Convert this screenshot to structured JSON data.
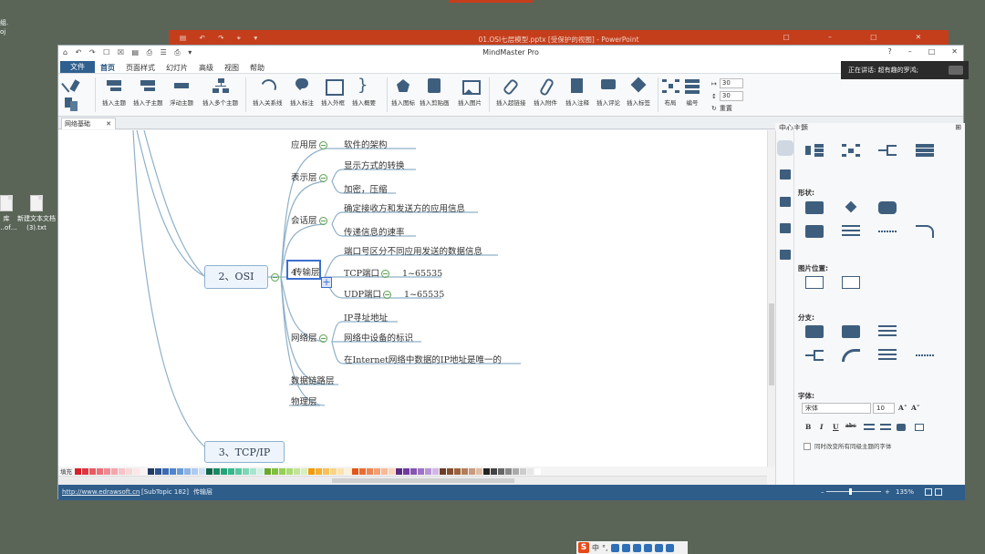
{
  "desktop": {
    "top_left_labels": [
      "组.",
      "oj"
    ],
    "icons": [
      {
        "label": "库\n…of…",
        "name": "desktop-file-partial"
      },
      {
        "label": "新建文本文档\n(3).txt",
        "name": "desktop-new-text-document"
      }
    ]
  },
  "powerpoint": {
    "title": "01.OSI七层模型.pptx [受保护的视图] - PowerPoint",
    "qat": "▤ ↶ ↷ ⌖ ▾",
    "controls": "□ – □ ✕"
  },
  "app": {
    "title": "MindMaster Pro",
    "qat": "⌂ ↶ ↷ ☐ ☒ ▤ ⎙ ☰ ⎙ ▾",
    "win_controls": [
      "?",
      "–",
      "□",
      "✕"
    ]
  },
  "menu": {
    "file": "文件",
    "tabs": [
      "首页",
      "页面样式",
      "幻灯片",
      "高级",
      "视图",
      "帮助"
    ],
    "active_index": 0
  },
  "ribbon": {
    "buttons": [
      "插入主题",
      "插入子主题",
      "浮动主题",
      "插入多个主题",
      "插入关系线",
      "插入标注",
      "插入外框",
      "插入概要",
      "插入图标",
      "插入剪贴画",
      "插入图片",
      "插入超链接",
      "插入附件",
      "插入注释",
      "插入评论",
      "插入标签",
      "布局",
      "编号"
    ],
    "spacing_h": "30",
    "spacing_v": "30",
    "reset": "重置"
  },
  "doc_tab": {
    "label": "网络基础",
    "close": "✕"
  },
  "mindmap": {
    "osi": "2、OSI",
    "tcpip": "3、TCP/IP",
    "layers": {
      "app": "应用层",
      "pres": "表示层",
      "session": "会话层",
      "transport": "传输层",
      "transport_cursor": "4",
      "network": "网络层",
      "datalink": "数据链路层",
      "physical": "物理层"
    },
    "details": {
      "app_1": "软件的架构",
      "pres_1": "显示方式的转换",
      "pres_2": "加密，压缩",
      "session_1": "确定接收方和发送方的应用信息",
      "session_2": "传递信息的速率",
      "transport_1": "端口号区分不同应用发送的数据信息",
      "tcp": "TCP端口",
      "tcp_range": "1~65535",
      "udp": "UDP端口",
      "udp_range": "1~65535",
      "net_1": "IP寻址地址",
      "net_2": "网络中设备的标识",
      "net_3": "在Internet网络中数据的IP地址是唯一的"
    }
  },
  "palette": {
    "label": "填充",
    "colors": [
      "#d6202c",
      "#e03640",
      "#e85a63",
      "#ec7179",
      "#ef8a91",
      "#f3a6ac",
      "#f7c3c7",
      "#f9d6d9",
      "#fbe6e8",
      "#fdf2f3",
      "#1f3b66",
      "#2c5290",
      "#3a6bb5",
      "#4f83ce",
      "#6a9bdb",
      "#8bb3e6",
      "#aecbef",
      "#cfe0f6",
      "#10654a",
      "#1a8a63",
      "#25a47a",
      "#38b68c",
      "#58c7a0",
      "#7fd5b7",
      "#a9e4ce",
      "#d2f1e5",
      "#6aa72b",
      "#7fbf3a",
      "#96cf54",
      "#aadb72",
      "#c1e596",
      "#d8efbb",
      "#f29a0b",
      "#f6ae2f",
      "#f8c15a",
      "#fad384",
      "#fce3ad",
      "#fdf0d4",
      "#e0561b",
      "#e86c34",
      "#ee8552",
      "#f29f74",
      "#f6ba98",
      "#fad4bd",
      "#5b2c83",
      "#6f3c9c",
      "#8655b3",
      "#9e73c5",
      "#b894d6",
      "#d2b7e6",
      "#6b3e24",
      "#844f2f",
      "#9c633e",
      "#b47d58",
      "#c99b7d",
      "#ddbda5",
      "#222222",
      "#444444",
      "#666666",
      "#888888",
      "#aaaaaa",
      "#cccccc",
      "#e6e6e6",
      "#ffffff"
    ]
  },
  "panel": {
    "title": "中心主题",
    "pin": "⊞",
    "sections": {
      "shape": "形状:",
      "image_pos": "图片位置:",
      "branch": "分支:",
      "font": "字体:"
    },
    "font_name": "宋体",
    "font_size": "10",
    "font_grow": "A˄",
    "font_shrink": "A˅",
    "format_buttons": [
      "B",
      "I",
      "U",
      "abc"
    ],
    "checkbox_label": "同时改变所有同级主题的字体"
  },
  "status": {
    "url": "http://www.edrawsoft.cn",
    "subtopic": "[SubTopic 182]",
    "selection": "传输层",
    "zoom_minus": "–",
    "zoom_plus": "+",
    "zoom_value": "135%",
    "zoom_fraction": 0.44
  },
  "notification": {
    "text": "正在讲话: 超有趣的罗鸿;"
  },
  "ime": {
    "logo": "S",
    "mode": "中",
    "punct": "°,"
  }
}
